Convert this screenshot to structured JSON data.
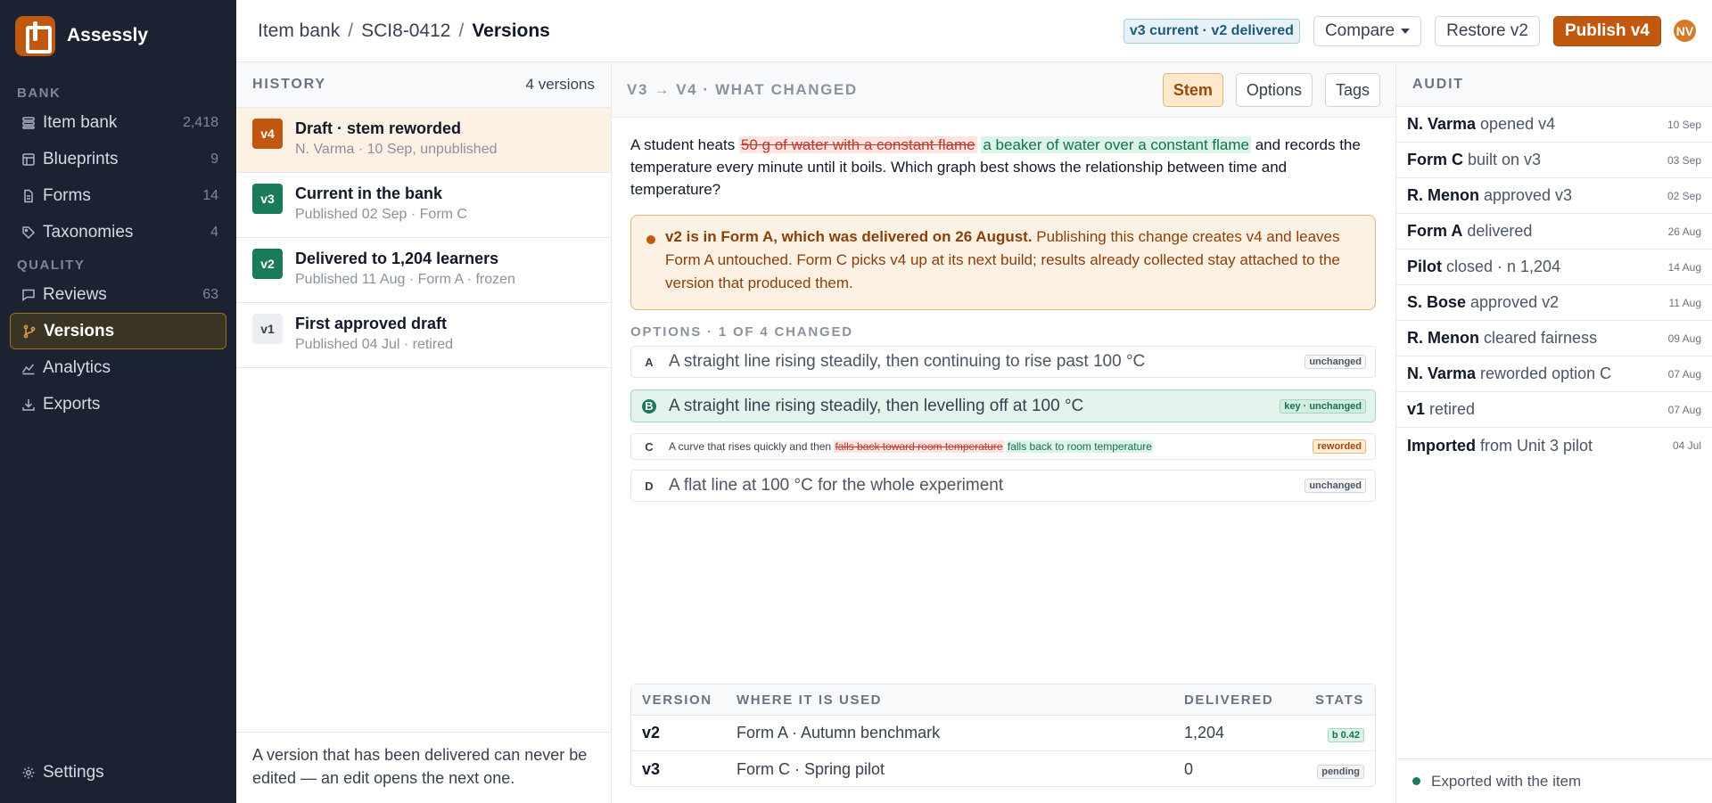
{
  "app": {
    "name": "Assessly",
    "logo_icon": "bracket-logo-icon",
    "accent": "#c0590f"
  },
  "sidebar": {
    "section_bank": "BANK",
    "bank_items": [
      {
        "label": "Item bank",
        "count": "2,418",
        "icon": "stack-icon"
      },
      {
        "label": "Blueprints",
        "count": "9",
        "icon": "grid-icon"
      },
      {
        "label": "Forms",
        "count": "14",
        "icon": "document-icon"
      },
      {
        "label": "Taxonomies",
        "count": "4",
        "icon": "tag-icon"
      }
    ],
    "section_quality": "QUALITY",
    "quality_items": [
      {
        "label": "Reviews",
        "count": "63",
        "icon": "chat-icon"
      },
      {
        "label": "Versions",
        "count": "",
        "icon": "branch-icon"
      },
      {
        "label": "Analytics",
        "count": "",
        "icon": "chart-icon"
      },
      {
        "label": "Exports",
        "count": "",
        "icon": "download-icon"
      }
    ],
    "settings_label": "Settings"
  },
  "header": {
    "breadcrumb": [
      "Item bank",
      "SCI8-0412",
      "Versions"
    ],
    "status_chip": "v3 current · v2 delivered",
    "compare_label": "Compare",
    "restore_label": "Restore v2",
    "publish_label": "Publish v4",
    "avatar_initials": "NV"
  },
  "history": {
    "title": "HISTORY",
    "count": "4 versions",
    "items": [
      {
        "badge": "v4",
        "title": "Draft · stem reworded",
        "sub": "N. Varma · 10 Sep, unpublished"
      },
      {
        "badge": "v3",
        "title": "Current in the bank",
        "sub": "Published 02 Sep · Form C"
      },
      {
        "badge": "v2",
        "title": "Delivered to 1,204 learners",
        "sub": "Published 11 Aug · Form A · frozen"
      },
      {
        "badge": "v1",
        "title": "First approved draft",
        "sub": "Published 04 Jul · retired"
      }
    ],
    "footer": "A version that has been delivered can never be edited — an edit opens the next one."
  },
  "diff": {
    "title": "V3 → V4 · WHAT CHANGED",
    "tabs": [
      "Stem",
      "Options",
      "Tags"
    ],
    "stem": {
      "pre": "A student heats ",
      "removed": "50 g of water with a constant flame",
      "added": "a beaker of water over a constant flame",
      "post": " and records the temperature every minute until it boils. Which graph best shows the relationship between time and temperature?"
    },
    "alert": {
      "bold": "v2 is in Form A, which was delivered on 26 August.",
      "text": " Publishing this change creates v4 and leaves Form A untouched. Form C picks v4 up at its next build; results already collected stay attached to the version that produced them."
    },
    "options_title": "OPTIONS · 1 OF 4 CHANGED",
    "options": [
      {
        "letter": "A",
        "text": "A straight line rising steadily, then continuing to rise past 100 °C",
        "tag": "unchanged"
      },
      {
        "letter": "B",
        "text": "A straight line rising steadily, then levelling off at 100 °C",
        "tag": "key · unchanged"
      },
      {
        "letter": "C",
        "pre": "A curve that rises quickly and then ",
        "removed": "falls back toward room temperature",
        "added": "falls back to room temperature",
        "tag": "reworded"
      },
      {
        "letter": "D",
        "text": "A flat line at 100 °C for the whole experiment",
        "tag": "unchanged"
      }
    ],
    "usage": {
      "headers": [
        "VERSION",
        "WHERE IT IS USED",
        "DELIVERED",
        "STATS"
      ],
      "rows": [
        {
          "version": "v2",
          "where": "Form A · Autumn benchmark",
          "delivered": "1,204",
          "stats": "b 0.42"
        },
        {
          "version": "v3",
          "where": "Form C · Spring pilot",
          "delivered": "0",
          "stats": "pending"
        }
      ]
    }
  },
  "audit": {
    "title": "AUDIT",
    "rows": [
      {
        "actor": "N. Varma",
        "action": "opened v4",
        "date": "10 Sep"
      },
      {
        "actor": "Form C",
        "action": "built on v3",
        "date": "03 Sep"
      },
      {
        "actor": "R. Menon",
        "action": "approved v3",
        "date": "02 Sep"
      },
      {
        "actor": "Form A",
        "action": "delivered",
        "date": "26 Aug"
      },
      {
        "actor": "Pilot",
        "action": "closed · n 1,204",
        "date": "14 Aug"
      },
      {
        "actor": "S. Bose",
        "action": "approved v2",
        "date": "11 Aug"
      },
      {
        "actor": "R. Menon",
        "action": "cleared fairness",
        "date": "09 Aug"
      },
      {
        "actor": "N. Varma",
        "action": "reworded option C",
        "date": "07 Aug"
      },
      {
        "actor": "v1",
        "action": "retired",
        "date": "07 Aug"
      },
      {
        "actor": "Imported",
        "action": "from Unit 3 pilot",
        "date": "04 Jul"
      }
    ],
    "footer": "Exported with the item"
  }
}
